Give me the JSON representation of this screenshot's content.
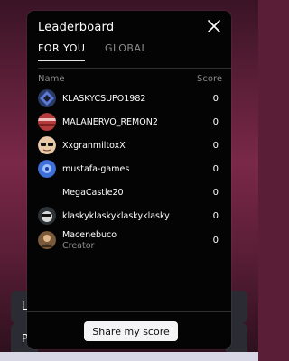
{
  "background": {
    "left_button_labels": [
      "L",
      "P"
    ]
  },
  "modal": {
    "title": "Leaderboard",
    "tabs": [
      {
        "label": "FOR YOU",
        "active": true
      },
      {
        "label": "GLOBAL",
        "active": false
      }
    ],
    "columns": {
      "name": "Name",
      "score": "Score"
    },
    "entries": [
      {
        "name": "KLASKYCSUPO1982",
        "subtitle": "",
        "score": "0",
        "avatar": "geometric-avatar"
      },
      {
        "name": "MALANERVO_REMON2",
        "subtitle": "",
        "score": "0",
        "avatar": "red-striped-avatar"
      },
      {
        "name": "XxgranmiltoxX",
        "subtitle": "",
        "score": "0",
        "avatar": "sunglasses-avatar"
      },
      {
        "name": "mustafa-games",
        "subtitle": "",
        "score": "0",
        "avatar": "blue-globe-avatar"
      },
      {
        "name": "MegaCastle20",
        "subtitle": "",
        "score": "0",
        "avatar": "no-avatar"
      },
      {
        "name": "klaskyklaskyklaskyklasky",
        "subtitle": "",
        "score": "0",
        "avatar": "dark-face-avatar"
      },
      {
        "name": "Macenebuco",
        "subtitle": "Creator",
        "score": "0",
        "avatar": "brown-avatar"
      }
    ],
    "share_button": "Share my score"
  }
}
